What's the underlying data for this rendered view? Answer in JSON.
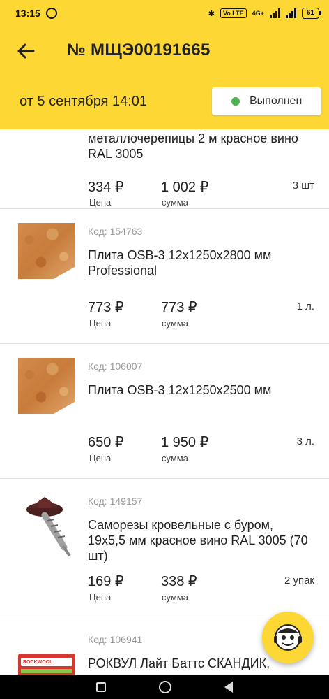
{
  "status_bar": {
    "time": "13:15",
    "network": "4G+",
    "volte": "Vo LTE",
    "battery": "61"
  },
  "header": {
    "title": "№ МЩЭ00191665",
    "date": "от 5 сентября 14:01",
    "status": "Выполнен",
    "status_color": "#4caf50",
    "accent_color": "#fdd835"
  },
  "labels": {
    "price": "Цена",
    "sum": "сумма"
  },
  "items": [
    {
      "code": "",
      "name": "металлочерепицы 2 м красное вино RAL 3005",
      "price": "334 ₽",
      "sum": "1 002 ₽",
      "qty": "3 шт",
      "icon": "roof-tile-thumbnail"
    },
    {
      "code": "Код: 154763",
      "name": "Плита OSB-3 12x1250x2800 мм Professional",
      "price": "773 ₽",
      "sum": "773 ₽",
      "qty": "1 л.",
      "icon": "osb-board-thumbnail"
    },
    {
      "code": "Код: 106007",
      "name": "Плита OSB-3 12x1250x2500 мм",
      "price": "650 ₽",
      "sum": "1 950 ₽",
      "qty": "3 л.",
      "icon": "osb-board-thumbnail"
    },
    {
      "code": "Код: 149157",
      "name": "Саморезы кровельные с буром, 19x5,5 мм красное вино RAL 3005 (70 шт)",
      "price": "169 ₽",
      "sum": "338 ₽",
      "qty": "2 упак",
      "icon": "roofing-screw-thumbnail"
    },
    {
      "code": "Код: 106941",
      "name": "РОКВУЛ Лайт Баттс СКАНДИК,",
      "price": "",
      "sum": "",
      "qty": "",
      "icon": "rockwool-package-thumbnail",
      "brand": "ROCKWOOL"
    }
  ],
  "fab": {
    "icon": "support-mascot-icon"
  }
}
